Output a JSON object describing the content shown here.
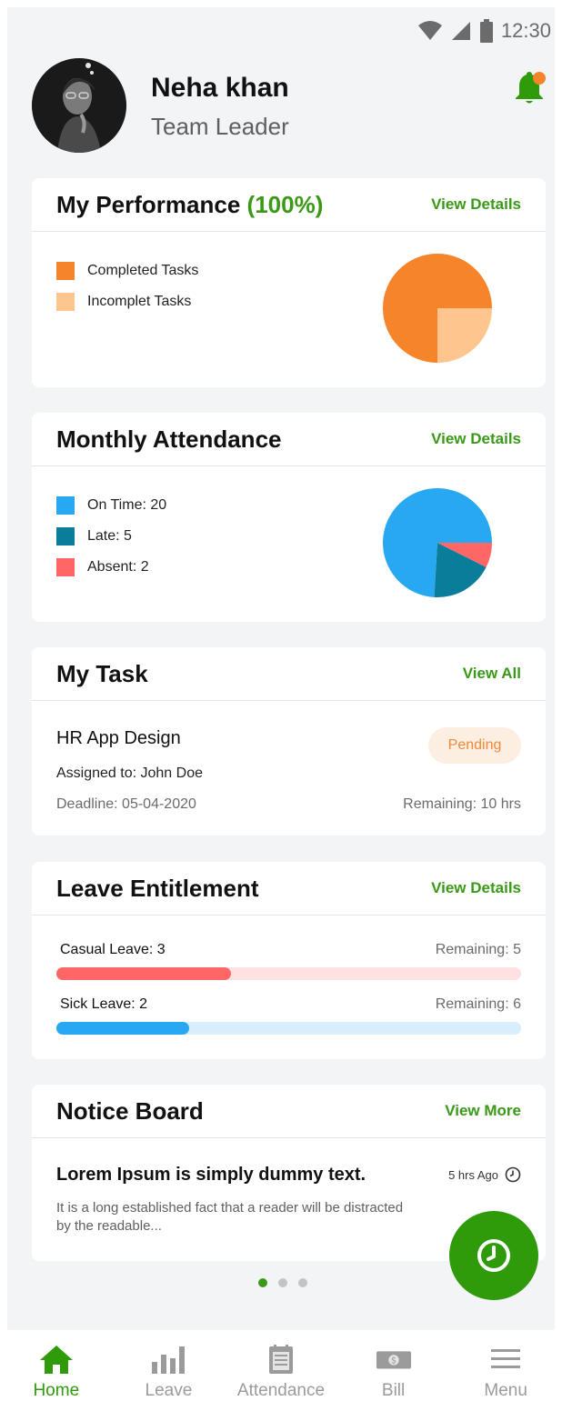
{
  "status_bar": {
    "time": "12:30"
  },
  "profile": {
    "name": "Neha khan",
    "role": "Team Leader"
  },
  "performance": {
    "title": "My Performance",
    "percent": "(100%)",
    "link": "View Details",
    "legend": [
      "Completed Tasks",
      "Incomplet Tasks"
    ],
    "colors": [
      "#f5842a",
      "#ffc58f"
    ]
  },
  "attendance": {
    "title": "Monthly Attendance",
    "link": "View Details",
    "legend": [
      "On Time: 20",
      "Late: 5",
      "Absent: 2"
    ],
    "colors": [
      "#29a8f2",
      "#0a7d9b",
      "#ff6767"
    ]
  },
  "chart_data": [
    {
      "type": "pie",
      "categories": [
        "Completed Tasks",
        "Incomplet Tasks"
      ],
      "values": [
        75,
        25
      ],
      "colors": [
        "#f5842a",
        "#ffc58f"
      ],
      "title": "My Performance (100%)"
    },
    {
      "type": "pie",
      "categories": [
        "On Time",
        "Late",
        "Absent"
      ],
      "values": [
        20,
        5,
        2
      ],
      "colors": [
        "#29a8f2",
        "#0a7d9b",
        "#ff6767"
      ],
      "title": "Monthly Attendance"
    }
  ],
  "task": {
    "title": "My Task",
    "link": "View All",
    "name": "HR App Design",
    "status": "Pending",
    "assigned": "Assigned to: John Doe",
    "deadline": "Deadline: 05-04-2020",
    "remaining": "Remaining: 10 hrs"
  },
  "leave": {
    "title": "Leave Entitlement",
    "link": "View Details",
    "items": [
      {
        "label": "Casual Leave: 3",
        "remaining": "Remaining:  5",
        "fraction": 0.375,
        "color": "#ff6767",
        "track": "#ffe1e1"
      },
      {
        "label": "Sick Leave: 2",
        "remaining": "Remaining:  6",
        "fraction": 0.285,
        "color": "#29a8f2",
        "track": "#d8eefc"
      }
    ]
  },
  "notice": {
    "title": "Notice Board",
    "link": "View More",
    "headline": "Lorem Ipsum is simply dummy text.",
    "time": "5 hrs Ago",
    "body": "It is a long established fact that a reader will be distracted by the readable..."
  },
  "nav": [
    {
      "label": "Home",
      "icon": "home-icon",
      "active": true
    },
    {
      "label": "Leave",
      "icon": "bar-chart-icon",
      "active": false
    },
    {
      "label": "Attendance",
      "icon": "calendar-checklist-icon",
      "active": false
    },
    {
      "label": "Bill",
      "icon": "banknote-icon",
      "active": false
    },
    {
      "label": "Menu",
      "icon": "hamburger-menu-icon",
      "active": false
    }
  ],
  "accent_color": "#3a9a18"
}
